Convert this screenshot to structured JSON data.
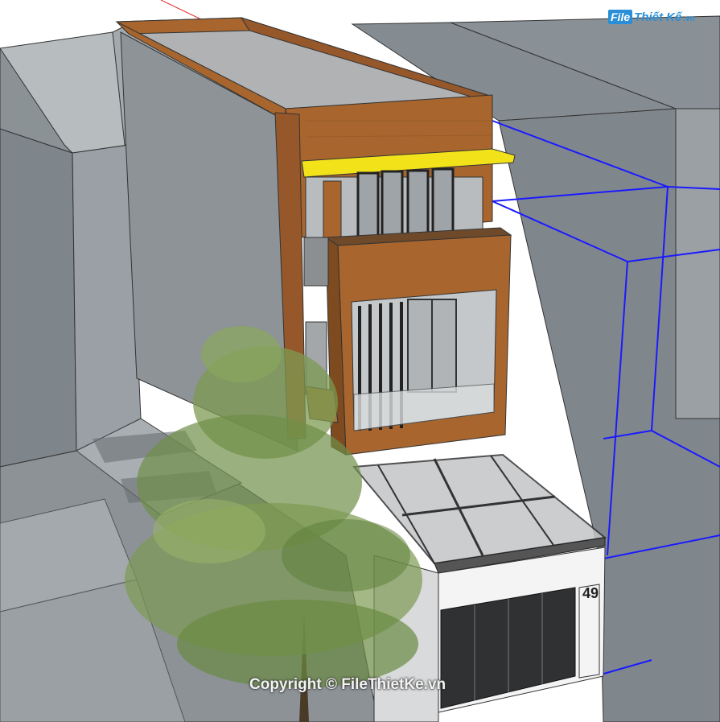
{
  "watermark": {
    "logo_mark": "File",
    "logo_word": "Thiết Kế",
    "logo_tld": ".vn",
    "copyright": "Copyright © FileThietKe.vn"
  },
  "house": {
    "number": "49"
  },
  "colors": {
    "sky": "#ffffff",
    "neighbor_block": "#8f969b",
    "neighbor_top": "#a7adb1",
    "street": "#9aa0a4",
    "wood": "#a8662e",
    "wood_dark": "#7e4a1f",
    "canopy_yellow": "#f2e21a",
    "ground_floor_white": "#f4f4f4",
    "selection_blue": "#1a1aff",
    "tree_foliage": "#7d9a52"
  }
}
